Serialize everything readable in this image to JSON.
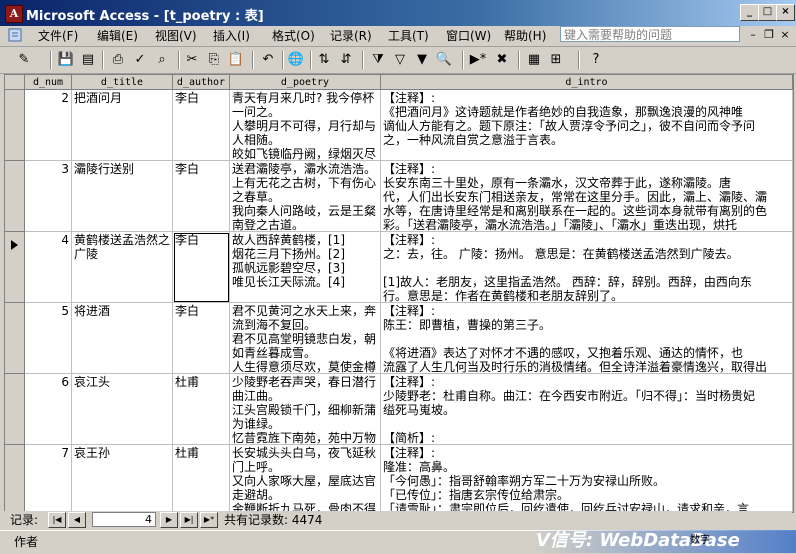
{
  "window": {
    "title": "Microsoft Access - [t_poetry : 表]",
    "app_icon_glyph": "A"
  },
  "menubar": {
    "items": [
      "文件(F)",
      "编辑(E)",
      "视图(V)",
      "插入(I)",
      "格式(O)",
      "记录(R)",
      "工具(T)",
      "窗口(W)",
      "帮助(H)"
    ],
    "help_placeholder": "键入需要帮助的问题"
  },
  "toolbar": {
    "icons": [
      "view-design-icon",
      "save-icon",
      "print-preview-icon",
      "print-icon",
      "spelling-icon",
      "cut-icon",
      "copy-icon",
      "paste-icon",
      "undo-icon",
      "hyperlink-icon",
      "sort-ascending-icon",
      "sort-descending-icon",
      "filter-by-selection-icon",
      "filter-by-form-icon",
      "apply-filter-icon",
      "find-icon",
      "new-record-icon",
      "delete-record-icon",
      "database-window-icon",
      "new-object-icon",
      "help-icon"
    ]
  },
  "table": {
    "columns": [
      "d_num",
      "d_title",
      "d_author",
      "d_poetry",
      "d_intro"
    ],
    "rows": [
      {
        "num": "2",
        "title": "把酒问月",
        "author": "李白",
        "poetry": [
          "青天有月来几时? 我今停杯",
          "一问之。",
          "人攀明月不可得，月行却与",
          "人相随。",
          "皎如飞镜临丹阙，绿烟灭尽"
        ],
        "intro": [
          "【注释】:",
          "《把酒问月》这诗题就是作者绝妙的自我造象，那飘逸浪漫的风神唯",
          "谪仙人方能有之。题下原注：「故人贾淳令予问之」，彼不自问而令予问",
          "之，一种风流自赏之意溢于言表。"
        ]
      },
      {
        "num": "3",
        "title": "灞陵行送别",
        "author": "李白",
        "poetry": [
          "送君灞陵亭，灞水流浩浩。",
          "上有无花之古树，下有伤心",
          "之春草。",
          "我向秦人问路岐，云是王粲",
          "南登之古道。"
        ],
        "intro": [
          "【注释】:",
          "长安东南三十里处，原有一条灞水，汉文帝葬于此，遂称灞陵。唐",
          "代，人们出长安东门相送亲友，常常在这里分手。因此，灞上、灞陵、灞",
          "水等，在唐诗里经常是和离别联系在一起的。这些词本身就带有离别的色",
          "彩。「送君灞陵亭，灞水流浩浩。」「灞陵」、「灞水」重迭出现，烘托"
        ]
      },
      {
        "num": "4",
        "title": "黄鹤楼送孟浩然之广陵",
        "author": "李白",
        "poetry": [
          "故人西辞黄鹤楼，[1]",
          "烟花三月下扬州。[2]",
          "孤帆远影碧空尽，[3]",
          "唯见长江天际流。[4]"
        ],
        "intro": [
          "【注释】:",
          "之：去，往。 广陵：扬州。 意思是：在黄鹤楼送孟浩然到广陵去。",
          "",
          "[1]故人：老朋友，这里指孟浩然。 西辞：辞，辞别。西辞，由西向东",
          "行。意思是：作者在黄鹤楼和老朋友辞别了。"
        ]
      },
      {
        "num": "5",
        "title": "将进酒",
        "author": "李白",
        "poetry": [
          "君不见黄河之水天上来，奔",
          "流到海不复回。",
          "君不见高堂明镜悲白发，朝",
          "如青丝暮成雪。",
          "人生得意须尽欢，莫使金樽"
        ],
        "intro": [
          "【注释】:",
          "陈王：即曹植，曹操的第三子。",
          "",
          "《将进酒》表达了对怀才不遇的感叹，又抱着乐观、通达的情怀，也",
          "流露了人生几何当及时行乐的消极情绪。但全诗洋溢着豪情逸兴，取得出"
        ]
      },
      {
        "num": "6",
        "title": "哀江头",
        "author": "杜甫",
        "poetry": [
          "少陵野老吞声哭，春日潜行",
          "曲江曲。",
          "江头宫殿锁千门，细柳新蒲",
          "为谁绿。",
          "忆昔霓旌下南苑，苑中万物"
        ],
        "intro": [
          "【注释】:",
          "少陵野老：杜甫自称。曲江：在今西安市附近。「归不得」：当时杨贵妃",
          "缢死马嵬坡。",
          "",
          "【简析】:"
        ]
      },
      {
        "num": "7",
        "title": "哀王孙",
        "author": "杜甫",
        "poetry": [
          "长安城头头白乌，夜飞延秋",
          "门上呼。",
          "又向人家啄大屋，屋底达官",
          "走避胡。",
          "金鞭断折九马死，骨肉不得"
        ],
        "intro": [
          "【注释】:",
          "隆准：高鼻。",
          "「今何愚」：指哥舒翰率朔方军二十万为安禄山所败。",
          "「已传位」：指唐玄宗传位给肃宗。",
          "「请雪耻」：肃宗即位后，回纥遣使，回纥兵讨安禄山，请求和亲，言"
        ]
      }
    ]
  },
  "navigator": {
    "label": "记录:",
    "current_record": "4",
    "count_text": "共有记录数: 4474"
  },
  "status": {
    "text": "作者",
    "watermark": "V信号: WebDataBase",
    "mode": "数字"
  }
}
